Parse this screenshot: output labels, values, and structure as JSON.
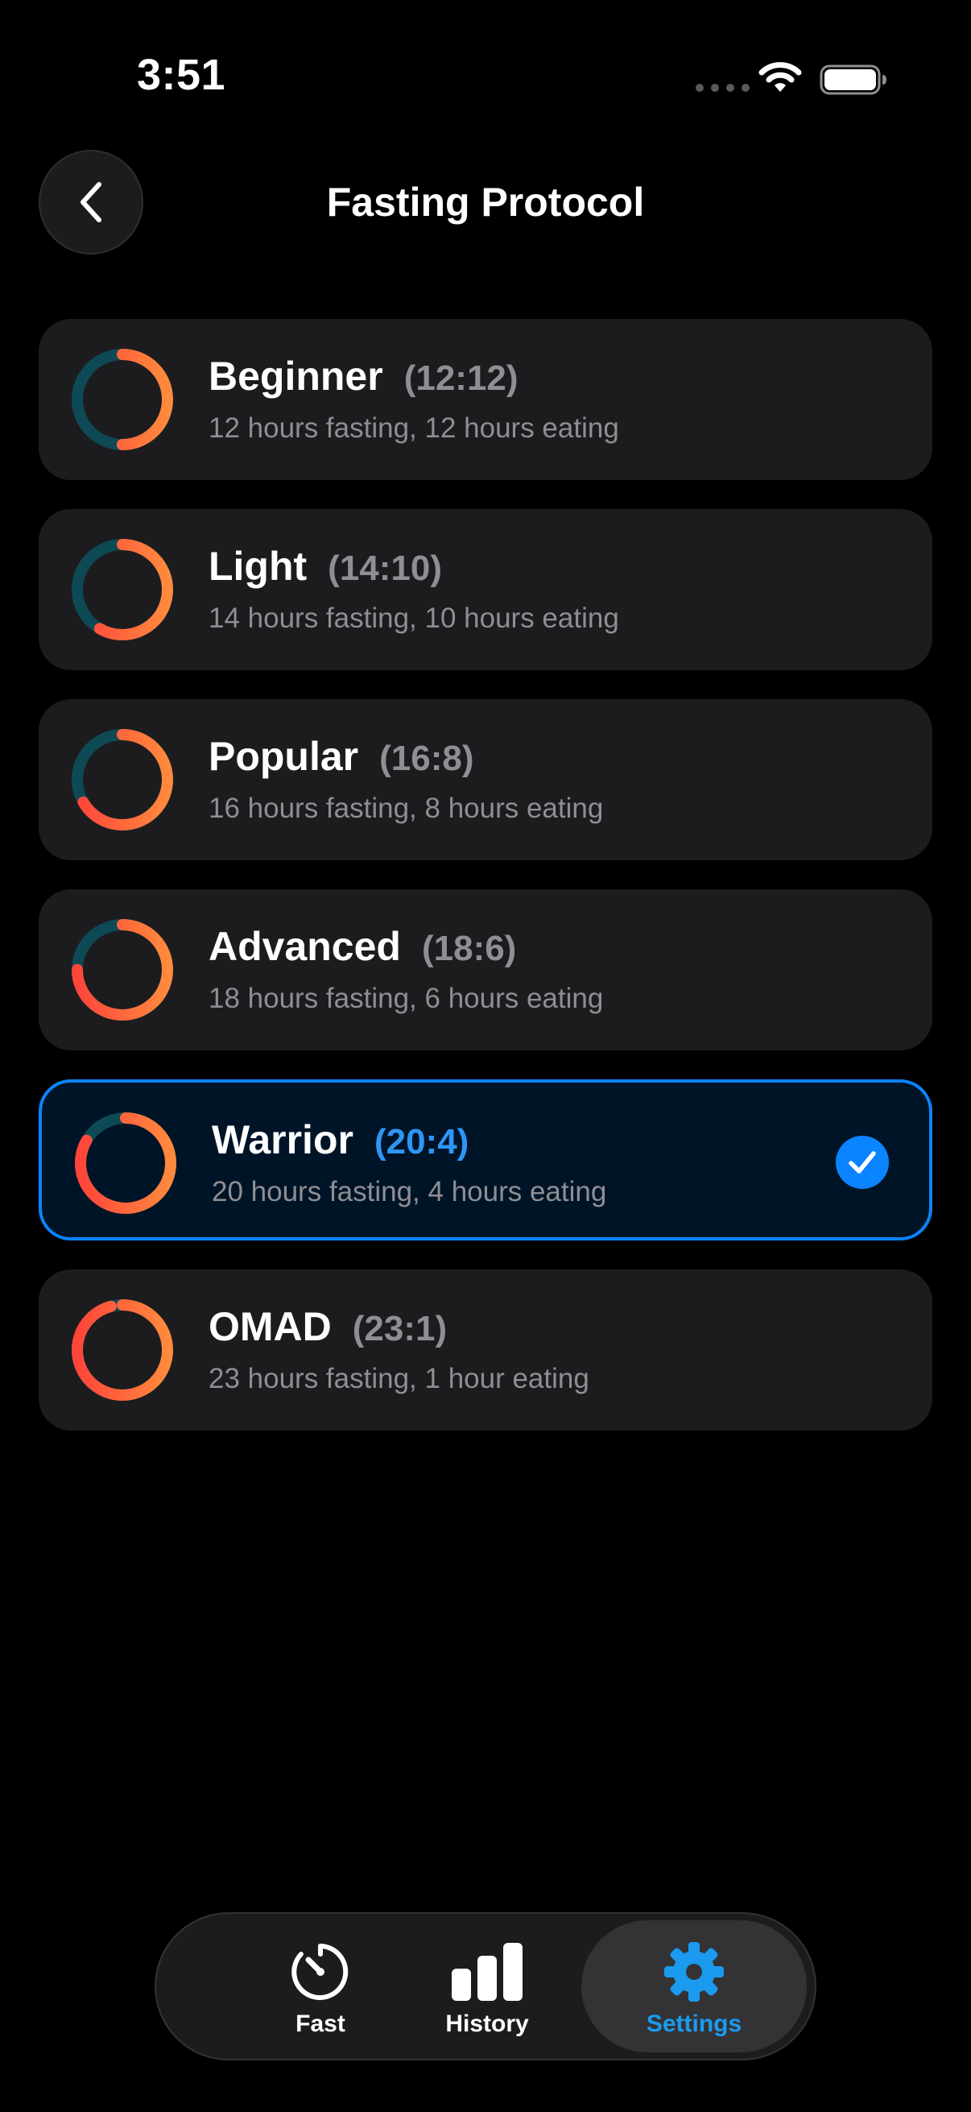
{
  "status_bar": {
    "time": "3:51"
  },
  "header": {
    "title": "Fasting Protocol",
    "back_icon": "chevron-left-icon"
  },
  "colors": {
    "accent": "#0a84ff",
    "ring_orange": "#ff8a3d",
    "ring_red": "#ff453a",
    "ring_teal": "#0e4a55",
    "card_bg": "#1c1c1e"
  },
  "protocols": [
    {
      "name": "Beginner",
      "ratio": "(12:12)",
      "description": "12 hours fasting, 12 hours eating",
      "fasting_hours": 12,
      "selected": false
    },
    {
      "name": "Light",
      "ratio": "(14:10)",
      "description": "14 hours fasting, 10 hours eating",
      "fasting_hours": 14,
      "selected": false
    },
    {
      "name": "Popular",
      "ratio": "(16:8)",
      "description": "16 hours fasting, 8 hours eating",
      "fasting_hours": 16,
      "selected": false
    },
    {
      "name": "Advanced",
      "ratio": "(18:6)",
      "description": "18 hours fasting, 6 hours eating",
      "fasting_hours": 18,
      "selected": false
    },
    {
      "name": "Warrior",
      "ratio": "(20:4)",
      "description": "20 hours fasting, 4 hours eating",
      "fasting_hours": 20,
      "selected": true
    },
    {
      "name": "OMAD",
      "ratio": "(23:1)",
      "description": "23 hours fasting, 1 hour eating",
      "fasting_hours": 23,
      "selected": false
    }
  ],
  "tab_bar": {
    "tabs": [
      {
        "label": "Fast",
        "icon": "timer-icon",
        "active": false
      },
      {
        "label": "History",
        "icon": "bar-chart-icon",
        "active": false
      },
      {
        "label": "Settings",
        "icon": "gear-icon",
        "active": true
      }
    ]
  }
}
